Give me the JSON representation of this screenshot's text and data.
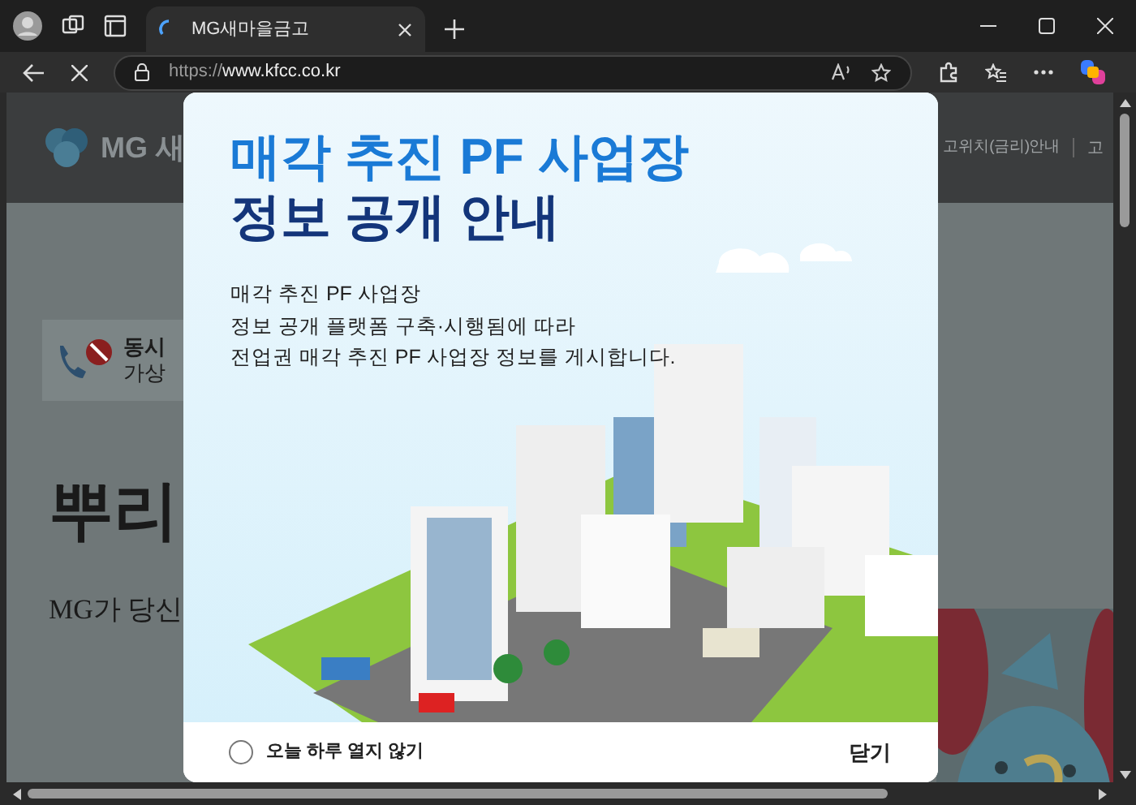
{
  "browser": {
    "tab_title": "MG새마을금고",
    "tab_loading": true,
    "url_scheme": "https://",
    "url_host": "www.kfcc.co.kr"
  },
  "background_page": {
    "logo_text": "MG 새",
    "nav_items": [
      "고위치(금리)안내",
      "고"
    ],
    "notice_lines": [
      "동시",
      "가상"
    ],
    "headline": "뿌리",
    "subline": "MG가 당신"
  },
  "popup": {
    "title_lines": [
      "매각 추진 PF 사업장",
      "정보 공개 안내"
    ],
    "body_lines": [
      "매각 추진 PF 사업장",
      "정보 공개 플랫폼 구축·시행됨에 따라",
      "전업권 매각 추진 PF 사업장 정보를 게시합니다."
    ],
    "dont_show_today": {
      "label": "오늘 하루 열지 않기",
      "checked": false
    },
    "close": "닫기"
  }
}
